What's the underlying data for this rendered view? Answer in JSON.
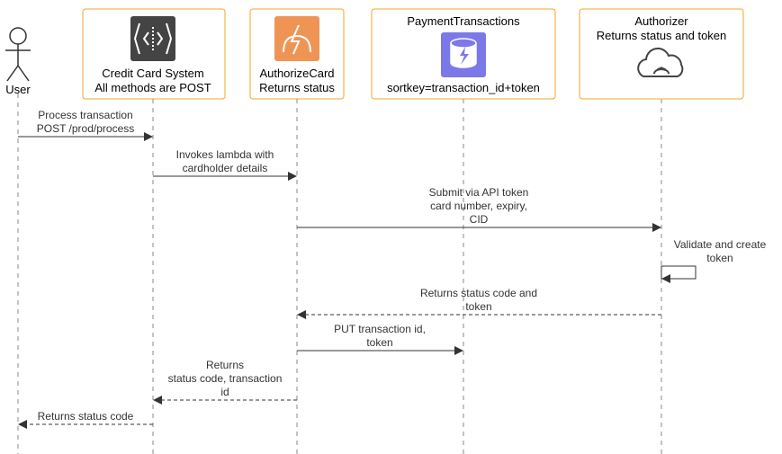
{
  "diagram": {
    "type": "sequence"
  },
  "participants": {
    "user": {
      "label": "User"
    },
    "ccs": {
      "line1": "Credit Card System",
      "line2": "All methods are POST"
    },
    "auth_card": {
      "line1": "AuthorizeCard",
      "line2": "Returns status"
    },
    "pay_tx": {
      "line1": "PaymentTransactions",
      "line2": "sortkey=transaction_id+token"
    },
    "authorizer": {
      "line1": "Authorizer",
      "line2": "Returns status and token"
    }
  },
  "messages": {
    "m1": {
      "line1": "Process transaction",
      "line2": "POST /prod/process"
    },
    "m2": {
      "line1": "Invokes lambda with",
      "line2": "cardholder details"
    },
    "m3": {
      "line1": "Submit via API token",
      "line2": "card number, expiry,",
      "line3": "CID"
    },
    "m4": {
      "line1": "Validate and create",
      "line2": "token"
    },
    "m5": {
      "line1": "Returns status code and",
      "line2": "token"
    },
    "m6": {
      "line1": "PUT transaction id,",
      "line2": "token"
    },
    "m7": {
      "line1": "Returns",
      "line2": "status code, transaction",
      "line3": "id"
    },
    "m8": {
      "line1": "Returns status code"
    }
  },
  "chart_data": {
    "type": "sequence_diagram",
    "participants": [
      "User",
      "Credit Card System",
      "AuthorizeCard",
      "PaymentTransactions",
      "Authorizer"
    ],
    "messages": [
      {
        "from": "User",
        "to": "Credit Card System",
        "label": "Process transaction POST /prod/process",
        "kind": "sync"
      },
      {
        "from": "Credit Card System",
        "to": "AuthorizeCard",
        "label": "Invokes lambda with cardholder details",
        "kind": "sync"
      },
      {
        "from": "AuthorizeCard",
        "to": "Authorizer",
        "label": "Submit via API token card number, expiry, CID",
        "kind": "sync"
      },
      {
        "from": "Authorizer",
        "to": "Authorizer",
        "label": "Validate and create token",
        "kind": "self"
      },
      {
        "from": "Authorizer",
        "to": "AuthorizeCard",
        "label": "Returns status code and token",
        "kind": "return"
      },
      {
        "from": "AuthorizeCard",
        "to": "PaymentTransactions",
        "label": "PUT transaction id, token",
        "kind": "sync"
      },
      {
        "from": "AuthorizeCard",
        "to": "Credit Card System",
        "label": "Returns status code, transaction id",
        "kind": "return"
      },
      {
        "from": "Credit Card System",
        "to": "User",
        "label": "Returns status code",
        "kind": "return"
      }
    ]
  }
}
